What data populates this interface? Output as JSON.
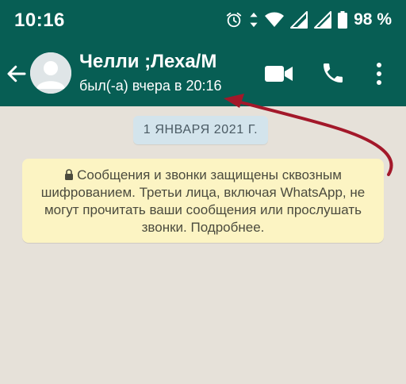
{
  "status_bar": {
    "time": "10:16",
    "battery_percent": "98 %",
    "icons": [
      "alarm-icon",
      "data-arrows-icon",
      "wifi-icon",
      "signal-icon",
      "signal-icon",
      "battery-icon"
    ]
  },
  "header": {
    "contact_name": "Челли ;Леха/М",
    "last_seen": "был(-а) вчера в 20:16",
    "icons": [
      "back-arrow-icon",
      "avatar-placeholder-icon",
      "video-call-icon",
      "phone-call-icon",
      "more-vert-icon"
    ]
  },
  "chat": {
    "date_chip": "1 ЯНВАРЯ 2021 Г.",
    "encryption_notice": "Сообщения и звонки защищены сквозным шифрованием. Третьи лица, включая WhatsApp, не могут прочитать ваши сообщения или прослушать звонки. Подробнее.",
    "encryption_icon": "lock-icon"
  },
  "colors": {
    "header_bg": "#075e54",
    "chat_bg": "#e6e1d9",
    "date_chip_bg": "#d3e4ec",
    "notice_bg": "#fcf4c3",
    "annotation_arrow": "#a3182a"
  }
}
